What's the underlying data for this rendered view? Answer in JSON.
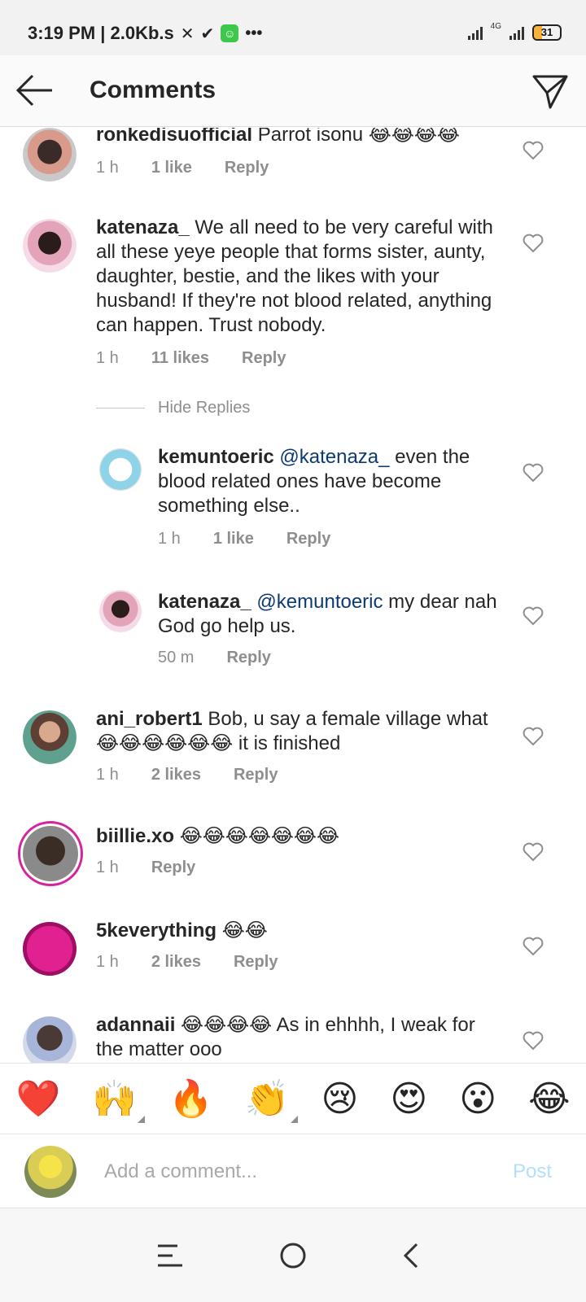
{
  "status_bar": {
    "time_speed": "3:19 PM | 2.0Kb.s",
    "battery": "31",
    "battery_level": 0.31,
    "network": "4G"
  },
  "header": {
    "title": "Comments"
  },
  "comments": [
    {
      "username": "ronkedisuofficial",
      "text": " Parrot isonu 😂😂😂😂",
      "time": "1 h",
      "likes": "1 like",
      "reply": "Reply"
    },
    {
      "username": "katenaza_",
      "text": " We all need to be very careful with all these yeye people that forms sister, aunty, daughter, bestie, and the likes with your husband! If they're not blood related, anything can happen. Trust nobody.",
      "time": "1 h",
      "likes": "11 likes",
      "reply": "Reply",
      "hide_replies": "Hide Replies",
      "replies": [
        {
          "username": "kemuntoeric",
          "mention": " @katenaza_",
          "text": " even the blood related ones have become something else..",
          "time": "1 h",
          "likes": "1 like",
          "reply": "Reply"
        },
        {
          "username": "katenaza_",
          "mention": " @kemuntoeric",
          "text": " my dear nah God go help us.",
          "time": "50 m",
          "reply": "Reply"
        }
      ]
    },
    {
      "username": "ani_robert1",
      "text": " Bob, u say a female village what 😂😂😂😂😂😂 it is finished",
      "time": "1 h",
      "likes": "2 likes",
      "reply": "Reply"
    },
    {
      "username": "biillie.xo",
      "text": " 😂😂😂😂😂😂😂",
      "time": "1 h",
      "reply": "Reply"
    },
    {
      "username": "5keverything",
      "text": " 😂😂",
      "time": "1 h",
      "likes": "2 likes",
      "reply": "Reply"
    },
    {
      "username": "adannaii",
      "text": " 😂😂😂😂 As in ehhhh, I weak for the matter ooo"
    }
  ],
  "emoji_bar": [
    "❤️",
    "🙌",
    "🔥",
    "👏",
    "😢",
    "😍",
    "😮",
    "😂"
  ],
  "composer": {
    "placeholder": "Add a comment...",
    "post_label": "Post"
  },
  "icons": {
    "back": "arrow-left-icon",
    "send": "paper-plane-icon",
    "like": "heart-outline-icon",
    "nav_menu": "menu-icon",
    "nav_home": "circle-home-icon",
    "nav_back": "chevron-left-icon"
  },
  "colors": {
    "text": "#262626",
    "meta": "#8e8e8e",
    "mention": "#0d3a75",
    "post_disabled": "#b2dffc",
    "story_ring": "#d6249f"
  }
}
